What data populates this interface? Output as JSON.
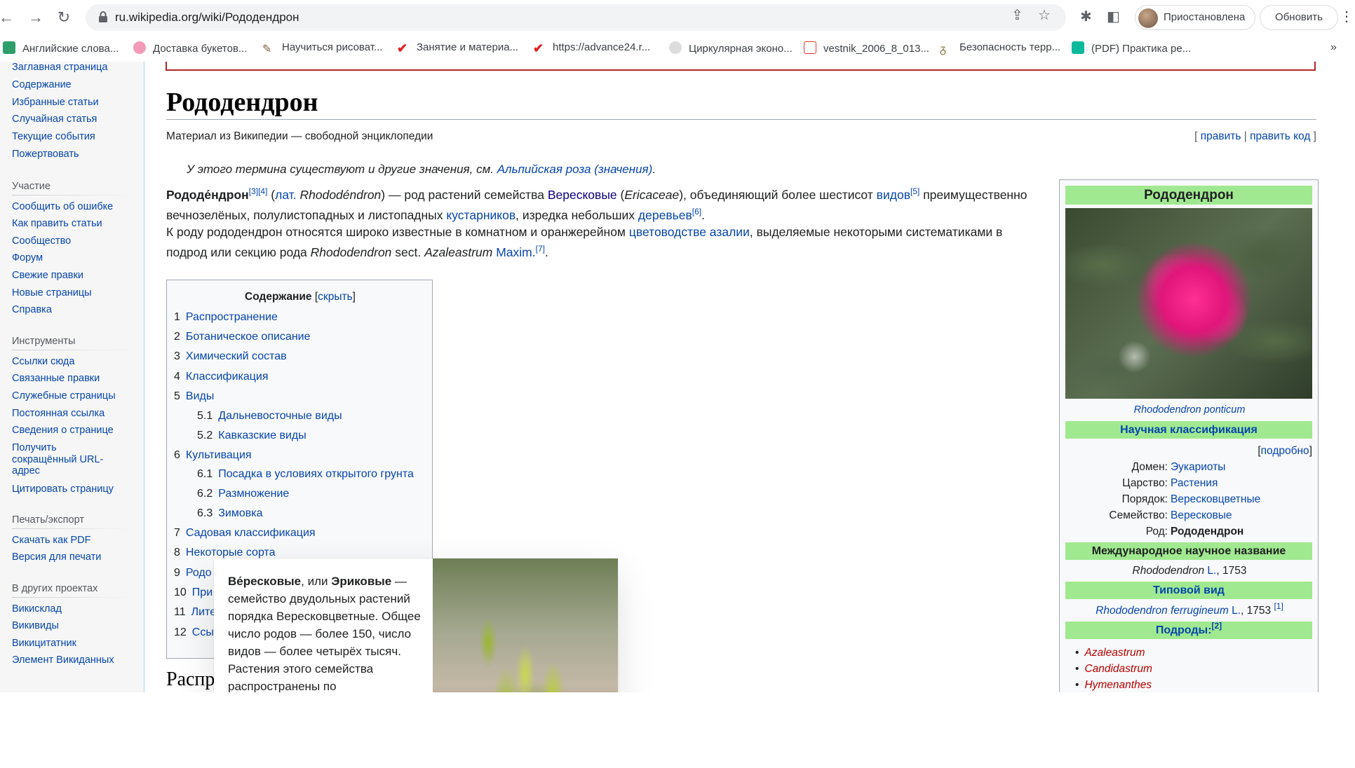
{
  "browser": {
    "url": "ru.wikipedia.org/wiki/Рододендрон",
    "profile_label": "Приостановлена",
    "update_label": "Обновить"
  },
  "bookmarks": [
    {
      "label": "Английские слова...",
      "color": "#2e9e6a"
    },
    {
      "label": "Доставка букетов...",
      "color": "#f29ab8"
    },
    {
      "label": "Научиться рисоват...",
      "color": "#7a5c3a"
    },
    {
      "label": "Занятие и материа...",
      "color": "#e02020"
    },
    {
      "label": "https://advance24.r...",
      "color": "#e02020"
    },
    {
      "label": "Циркулярная эконо...",
      "color": "#888888"
    },
    {
      "label": "vestnik_2006_8_013...",
      "color": "#e53935"
    },
    {
      "label": "Безопасность терр...",
      "color": "#8a7a40"
    },
    {
      "label": "(PDF) Практика ре...",
      "color": "#0fb99c"
    }
  ],
  "bookmarks_more": "»",
  "sidebar": {
    "nav": [
      "Заглавная страница",
      "Содержание",
      "Избранные статьи",
      "Случайная статья",
      "Текущие события",
      "Пожертвовать"
    ],
    "participation_head": "Участие",
    "participation": [
      "Сообщить об ошибке",
      "Как править статьи",
      "Сообщество",
      "Форум",
      "Свежие правки",
      "Новые страницы",
      "Справка"
    ],
    "tools_head": "Инструменты",
    "tools": [
      "Ссылки сюда",
      "Связанные правки",
      "Служебные страницы",
      "Постоянная ссылка",
      "Сведения о странице",
      "Получить",
      "сокращённый URL-",
      "адрес",
      "Цитировать страницу"
    ],
    "print_head": "Печать/экспорт",
    "print": [
      "Скачать как PDF",
      "Версия для печати"
    ],
    "projects_head": "В других проектах",
    "projects": [
      "Викисклад",
      "Викивиды",
      "Викицитатник",
      "Элемент Викиданных"
    ]
  },
  "article": {
    "title": "Рододендрон",
    "tagline": "Материал из Википедии — свободной энциклопедии",
    "edit_open": "[ ",
    "edit": "править",
    "edit_sep": " | ",
    "edit_code": "править код",
    "edit_close": " ]",
    "hatnote_prefix": "У этого термина существуют и другие значения, см. ",
    "hatnote_link": "Альпийская роза (значения)",
    "hatnote_suffix": ".",
    "p1": {
      "term": "Рододе́ндрон",
      "refs1": "[3][4]",
      "open": " (",
      "lat": "лат.",
      "latin_name": " Rhododéndron",
      "mid1": ") — род растений семейства ",
      "family": "Вересковые",
      "mid2": " (",
      "family_lat": "Ericaceae",
      "mid3": "), объединяющий более шестисот ",
      "species": "видов",
      "ref5": "[5]",
      "mid4": " преимущественно",
      "line2a": "вечнозелёных, полулистопадных и листопадных ",
      "shrubs": "кустарников",
      "line2b": ", изредка небольших ",
      "trees": "деревьев",
      "ref6": "[6]",
      "line2c": "."
    },
    "p2": {
      "a": "К роду рододендрон относятся широко известные в комнатном и оранжерейном ",
      "link": "цветоводстве азалии",
      "b": ", выделяемые некоторыми систематиками в",
      "c": "подрод или секцию рода ",
      "genus": "Rhododendron",
      "d": " sect. ",
      "sect": "Azaleastrum",
      "author": " Maxim.",
      "ref7": "[7]",
      "e": "."
    },
    "toc": {
      "title": "Содержание",
      "hide_open": " [",
      "hide": "скрыть",
      "hide_close": "]",
      "items": [
        {
          "num": "1",
          "label": "Распространение"
        },
        {
          "num": "2",
          "label": "Ботаническое описание"
        },
        {
          "num": "3",
          "label": "Химический состав"
        },
        {
          "num": "4",
          "label": "Классификация"
        },
        {
          "num": "5",
          "label": "Виды"
        },
        {
          "num": "5.1",
          "label": "Дальневосточные виды"
        },
        {
          "num": "5.2",
          "label": "Кавказские виды"
        },
        {
          "num": "6",
          "label": "Культивация"
        },
        {
          "num": "6.1",
          "label": "Посадка в условиях открытого грунта"
        },
        {
          "num": "6.2",
          "label": "Размножение"
        },
        {
          "num": "6.3",
          "label": "Зимовка"
        },
        {
          "num": "7",
          "label": "Садовая классификация"
        },
        {
          "num": "8",
          "label": "Некоторые сорта"
        },
        {
          "num": "9",
          "label": "Родо"
        },
        {
          "num": "10",
          "label": "При"
        },
        {
          "num": "11",
          "label": "Лите"
        },
        {
          "num": "12",
          "label": "Ссы"
        }
      ]
    },
    "next_heading_fragment": "Распр"
  },
  "popup": {
    "term1": "Ве́рескoвые",
    "mid": ", или ",
    "term2": "Эриковые",
    "text": " — семейство двудольных растений порядка Вересковцветные. Общее число родов — более 150, число видов — более четырёх тысяч. Растения этого семейства распространены по"
  },
  "infobox": {
    "title": "Рододендрон",
    "caption": "Rhododendron ponticum",
    "sci_class": "Научная классификация",
    "details_open": "[",
    "details": "подробно",
    "details_close": "]",
    "rows": [
      {
        "key": "Домен:",
        "value": "Эукариоты"
      },
      {
        "key": "Царство:",
        "value": "Растения"
      },
      {
        "key": "Порядок:",
        "value": "Вересковцветные"
      },
      {
        "key": "Семейство:",
        "value": "Вересковые"
      },
      {
        "key": "Род:",
        "value": "Рододендрон"
      }
    ],
    "intl_name_head": "Международное научное название",
    "intl_name": "Rhododendron",
    "intl_author": " L.",
    "intl_year": ", 1753",
    "type_head": "Типовой вид",
    "type_species": "Rhododendron ferrugineum",
    "type_author": " L.",
    "type_year": ", 1753 ",
    "type_ref": "[1]",
    "subgenera_head": "Подроды:",
    "subgenera_ref": "[2]",
    "subgenera": [
      "Azaleastrum",
      "Candidastrum",
      "Hymenanthes"
    ]
  }
}
